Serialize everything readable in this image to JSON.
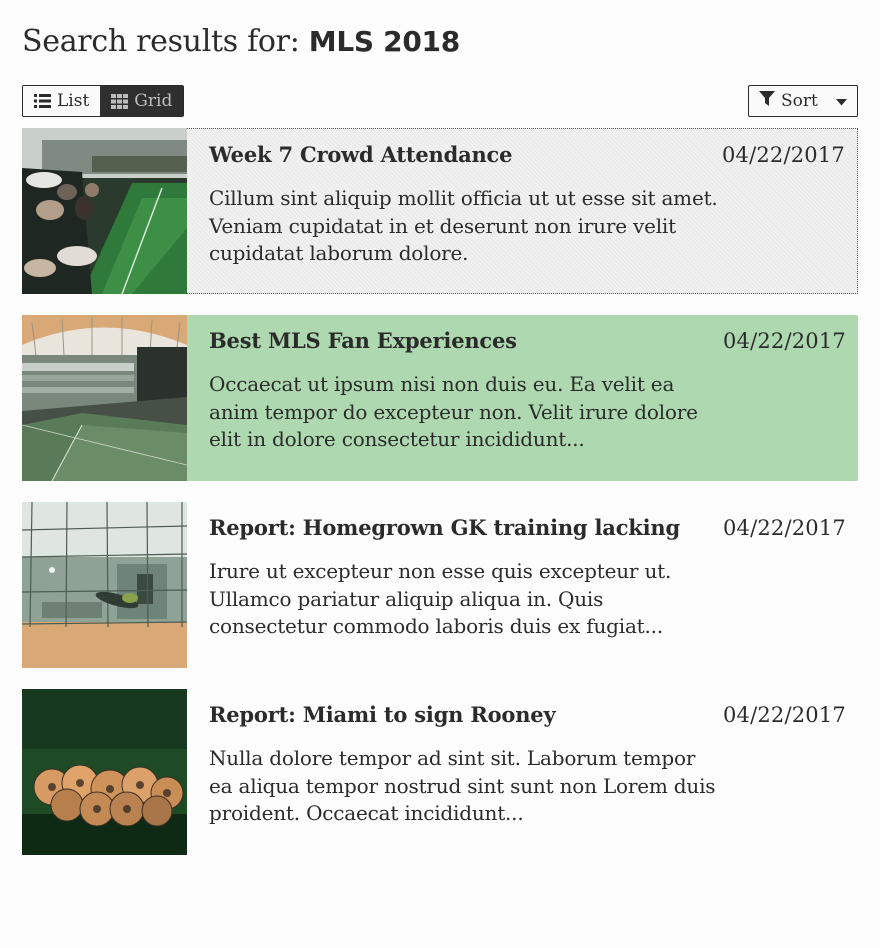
{
  "header": {
    "title_prefix": "Search results for: ",
    "query": "MLS 2018"
  },
  "view_toggle": {
    "list_label": "List",
    "grid_label": "Grid",
    "active": "Grid"
  },
  "sort": {
    "label": "Sort"
  },
  "results": [
    {
      "title": "Week 7 Crowd Attendance",
      "date": "04/22/2017",
      "excerpt": "Cillum sint aliquip mollit officia ut ut esse sit amet. Veniam cupidatat in et deserunt non irure velit cupidatat laborum dolore.",
      "thumbnail": "crowd-photo"
    },
    {
      "title": "Best MLS Fan Experiences",
      "date": "04/22/2017",
      "excerpt": "Occaecat ut ipsum nisi non duis eu. Ea velit ea anim tempor do excepteur non. Velit irure dolore elit in dolore consectetur incididunt...",
      "thumbnail": "stadium-photo"
    },
    {
      "title": "Report: Homegrown GK training lacking",
      "date": "04/22/2017",
      "excerpt": "Irure ut excepteur non esse quis excepteur ut. Ullamco pariatur aliquip aliqua in. Quis consectetur commodo laboris duis ex fugiat...",
      "thumbnail": "goalkeeper-photo"
    },
    {
      "title": "Report: Miami to sign Rooney",
      "date": "04/22/2017",
      "excerpt": "Nulla dolore tempor ad sint sit. Laborum tempor ea aliqua tempor nostrud sint sunt non Lorem duis proident. Occaecat incididunt...",
      "thumbnail": "soccer-balls-photo"
    }
  ],
  "colors": {
    "highlight": "#aed9b0",
    "text": "#2b2b2b",
    "toggle_active_bg": "#2f2f2f"
  },
  "icons": [
    "list-icon",
    "grid-icon",
    "filter-icon",
    "caret-down-icon"
  ]
}
